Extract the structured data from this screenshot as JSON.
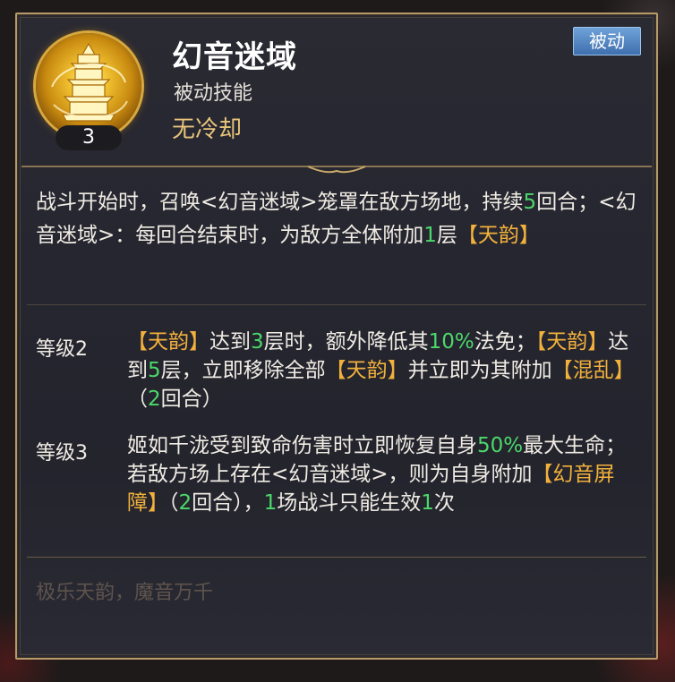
{
  "skill": {
    "name": "幻音迷域",
    "type": "被动技能",
    "cooldown": "无冷却",
    "level": "3",
    "tag": "被动",
    "icon": "golden-tower-icon"
  },
  "description": [
    {
      "t": "战斗开始时，召唤<幻音迷域>笼罩在敌方场地，持续",
      "c": ""
    },
    {
      "t": "5",
      "c": "green"
    },
    {
      "t": "回合；<幻音迷域>：每回合结束时，为敌方全体附加",
      "c": ""
    },
    {
      "t": "1",
      "c": "green"
    },
    {
      "t": "层",
      "c": ""
    },
    {
      "t": "【天韵】",
      "c": "gold"
    }
  ],
  "levels": [
    {
      "label": "等级2",
      "segments": [
        {
          "t": "【天韵】",
          "c": "gold"
        },
        {
          "t": "达到",
          "c": ""
        },
        {
          "t": "3",
          "c": "green"
        },
        {
          "t": "层时，额外降低其",
          "c": ""
        },
        {
          "t": "10%",
          "c": "green"
        },
        {
          "t": "法免；",
          "c": ""
        },
        {
          "t": "【天韵】",
          "c": "gold"
        },
        {
          "t": "达到",
          "c": ""
        },
        {
          "t": "5",
          "c": "green"
        },
        {
          "t": "层，立即移除全部",
          "c": ""
        },
        {
          "t": "【天韵】",
          "c": "gold"
        },
        {
          "t": "并立即为其附加",
          "c": ""
        },
        {
          "t": "【混乱】",
          "c": "gold"
        },
        {
          "t": "（",
          "c": ""
        },
        {
          "t": "2",
          "c": "green"
        },
        {
          "t": "回合）",
          "c": ""
        }
      ]
    },
    {
      "label": "等级3",
      "segments": [
        {
          "t": "姬如千泷受到致命伤害时立即恢复自身",
          "c": ""
        },
        {
          "t": "50%",
          "c": "green"
        },
        {
          "t": "最大生命；若敌方场上存在<幻音迷域>，则为自身附加",
          "c": ""
        },
        {
          "t": "【幻音屏障】",
          "c": "gold"
        },
        {
          "t": "（",
          "c": ""
        },
        {
          "t": "2",
          "c": "green"
        },
        {
          "t": "回合），",
          "c": ""
        },
        {
          "t": "1",
          "c": "green"
        },
        {
          "t": "场战斗只能生效",
          "c": ""
        },
        {
          "t": "1",
          "c": "green"
        },
        {
          "t": "次",
          "c": ""
        }
      ]
    }
  ],
  "flavor": "极乐天韵，魔音万千",
  "colors": {
    "highlight_green": "#4bd86a",
    "highlight_gold": "#f2b13c",
    "border_gold": "#b79a6a",
    "tag_blue": "#3f6fae"
  }
}
